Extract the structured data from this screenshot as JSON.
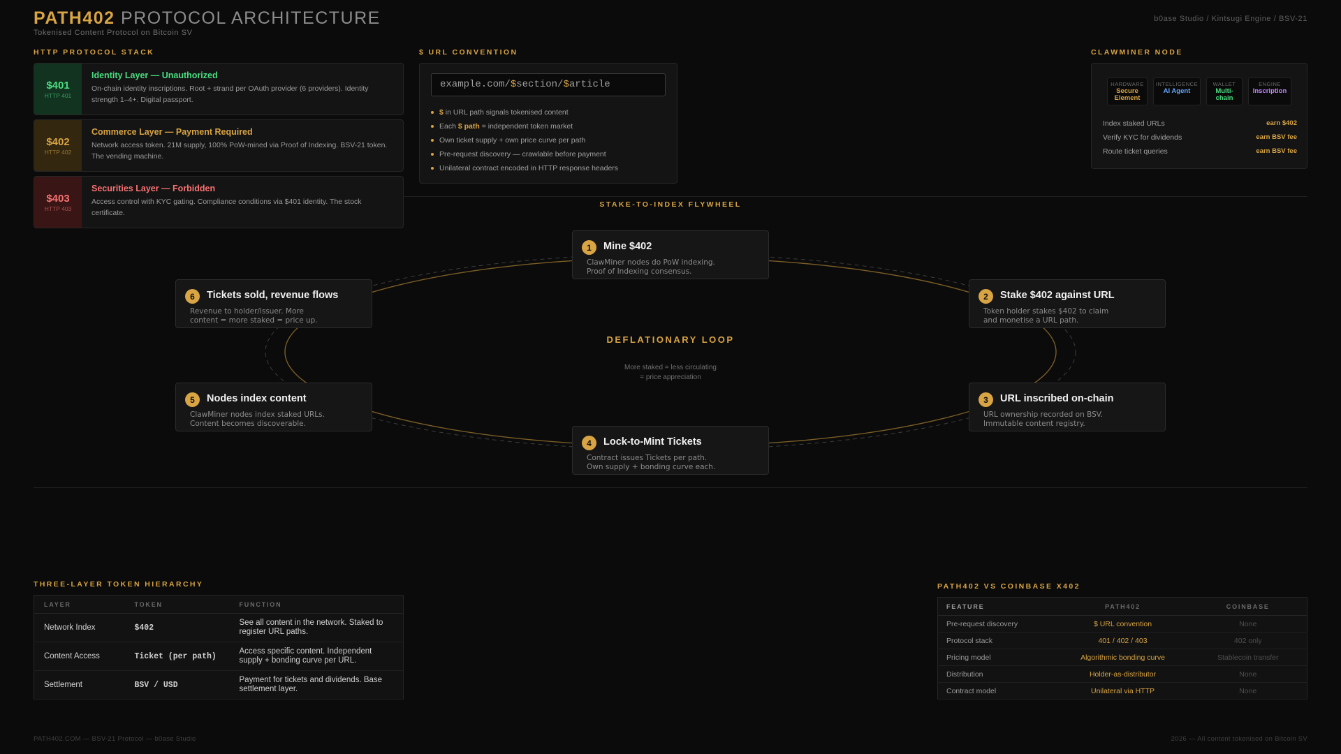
{
  "header": {
    "brand": "PATH402",
    "title_rest": "PROTOCOL ARCHITECTURE",
    "subtitle": "Tokenised Content Protocol on Bitcoin SV",
    "meta": "b0ase Studio / Kintsugi Engine / BSV-21"
  },
  "colors": {
    "accent": "#d9a443",
    "green": "#4ade80",
    "red": "#f87171",
    "blue": "#60a5fa",
    "purple": "#c084fc",
    "background": "#0b0b0b"
  },
  "http_stack": {
    "label": "HTTP PROTOCOL STACK",
    "layers": [
      {
        "code": "$401",
        "http": "HTTP 401",
        "name": "Identity Layer — Unauthorized",
        "desc": "On-chain identity inscriptions. Root + strand per OAuth provider (6 providers). Identity strength 1–4+. Digital passport."
      },
      {
        "code": "$402",
        "http": "HTTP 402",
        "name": "Commerce Layer — Payment Required",
        "desc": "Network access token. 21M supply, 100% PoW-mined via Proof of Indexing. BSV-21 token. The vending machine."
      },
      {
        "code": "$403",
        "http": "HTTP 403",
        "name": "Securities Layer — Forbidden",
        "desc": "Access control with KYC gating. Compliance conditions via $401 identity. The stock certificate."
      }
    ]
  },
  "url_convention": {
    "label": "$ URL CONVENTION",
    "url": {
      "p1": "example.com/",
      "d1": "$",
      "p2": "section/",
      "d2": "$",
      "p3": "article"
    },
    "bullets": [
      {
        "b": "$",
        "t": " in URL path signals tokenised content"
      },
      {
        "pre": "Each ",
        "b": "$ path",
        "t": " = independent token market"
      },
      {
        "t": "Own ticket supply + own price curve per path"
      },
      {
        "t": "Pre-request discovery — crawlable before payment"
      },
      {
        "t": "Unilateral contract encoded in HTTP response headers"
      }
    ]
  },
  "clawminer": {
    "label": "CLAWMINER NODE",
    "chips": [
      {
        "label": "HARDWARE",
        "value": "Secure Element"
      },
      {
        "label": "INTELLIGENCE",
        "value": "AI Agent"
      },
      {
        "label": "WALLET",
        "value": "Multi-chain"
      },
      {
        "label": "ENGINE",
        "value": "Inscription"
      }
    ],
    "rows": [
      {
        "label": "Index staked URLs",
        "value": "earn $402"
      },
      {
        "label": "Verify KYC for dividends",
        "value": "earn BSV fee"
      },
      {
        "label": "Route ticket queries",
        "value": "earn BSV fee"
      }
    ]
  },
  "flywheel": {
    "label": "STAKE-TO-INDEX FLYWHEEL",
    "center_title": "DEFLATIONARY LOOP",
    "center_desc_1": "More staked = less circulating",
    "center_desc_2": "= price appreciation",
    "steps": [
      {
        "num": "1",
        "title": "Mine $402",
        "d1": "ClawMiner nodes do PoW indexing.",
        "d2": "Proof of Indexing consensus."
      },
      {
        "num": "2",
        "title": "Stake $402 against URL",
        "d1": "Token holder stakes $402 to claim",
        "d2": "and monetise a URL path."
      },
      {
        "num": "3",
        "title": "URL inscribed on-chain",
        "d1": "URL ownership recorded on BSV.",
        "d2": "Immutable content registry."
      },
      {
        "num": "4",
        "title": "Lock-to-Mint Tickets",
        "d1": "Contract issues Tickets per path.",
        "d2": "Own supply + bonding curve each."
      },
      {
        "num": "5",
        "title": "Nodes index content",
        "d1": "ClawMiner nodes index staked URLs.",
        "d2": "Content becomes discoverable."
      },
      {
        "num": "6",
        "title": "Tickets sold, revenue flows",
        "d1": "Revenue to holder/issuer. More",
        "d2": "content = more staked = price up."
      }
    ]
  },
  "hierarchy": {
    "label": "THREE-LAYER TOKEN HIERARCHY",
    "headers": [
      "LAYER",
      "TOKEN",
      "FUNCTION"
    ],
    "rows": [
      [
        "Network Index",
        "$402",
        "See all content in the network. Staked to register URL paths."
      ],
      [
        "Content Access",
        "Ticket (per path)",
        "Access specific content. Independent supply + bonding curve per URL."
      ],
      [
        "Settlement",
        "BSV / USD",
        "Payment for tickets and dividends. Base settlement layer."
      ]
    ]
  },
  "comparison": {
    "label": "PATH402 VS COINBASE X402",
    "headers": [
      "FEATURE",
      "PATH402",
      "COINBASE"
    ],
    "rows": [
      [
        "Pre-request discovery",
        "$ URL convention",
        "None"
      ],
      [
        "Protocol stack",
        "401 / 402 / 403",
        "402 only"
      ],
      [
        "Pricing model",
        "Algorithmic bonding curve",
        "Stablecoin transfer"
      ],
      [
        "Distribution",
        "Holder-as-distributor",
        "None"
      ],
      [
        "Contract model",
        "Unilateral via HTTP",
        "None"
      ]
    ]
  },
  "footer": {
    "left": "PATH402.COM — BSV-21 Protocol — b0ase Studio",
    "right": "2026 — All content tokenised on Bitcoin SV"
  }
}
